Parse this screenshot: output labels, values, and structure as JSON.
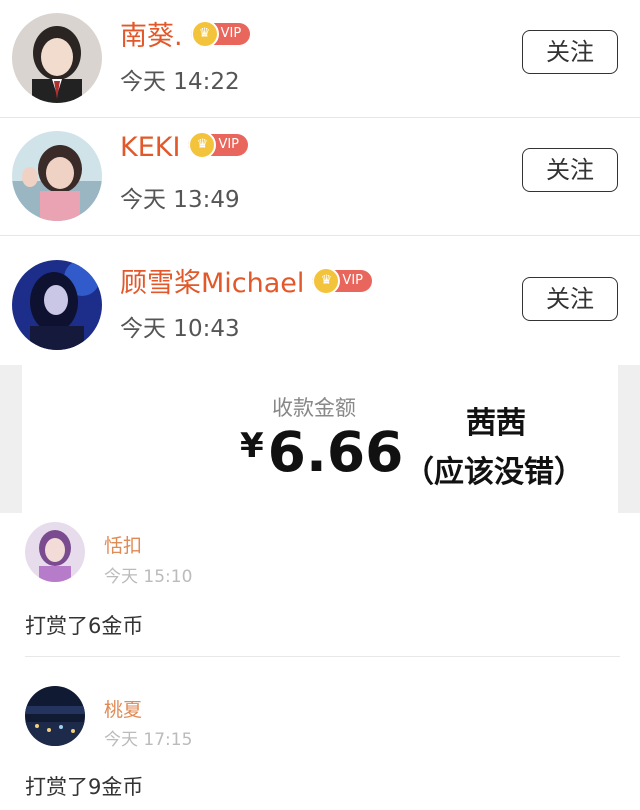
{
  "follow_list": [
    {
      "name": "南葵.",
      "time": "今天 14:22",
      "vip": "VIP",
      "button": "关注",
      "avatar_icon": "avatar-girl-school-uniform"
    },
    {
      "name": "KEKI",
      "time": "今天 13:49",
      "vip": "VIP",
      "button": "关注",
      "avatar_icon": "avatar-girl-pink-hair"
    },
    {
      "name": "顾雪桨Michael",
      "time": "今天 10:43",
      "vip": "VIP",
      "button": "关注",
      "avatar_icon": "avatar-girl-blue-neon"
    }
  ],
  "payment": {
    "label": "收款金额",
    "currency_symbol": "¥",
    "amount": "6.66",
    "note_line1": "茜茜",
    "note_line2": "（应该没错）"
  },
  "rewards": [
    {
      "name": "恬扣",
      "time": "今天 15:10",
      "message": "打赏了6金币",
      "avatar_icon": "avatar-purple-girl"
    },
    {
      "name": "桃夏",
      "time": "今天 17:15",
      "message": "打赏了9金币",
      "avatar_icon": "avatar-night-city"
    }
  ],
  "colors": {
    "username": "#e2582a",
    "vip_badge": "#e8665c",
    "crown": "#f3c43b",
    "reward_name": "#e08a55"
  }
}
